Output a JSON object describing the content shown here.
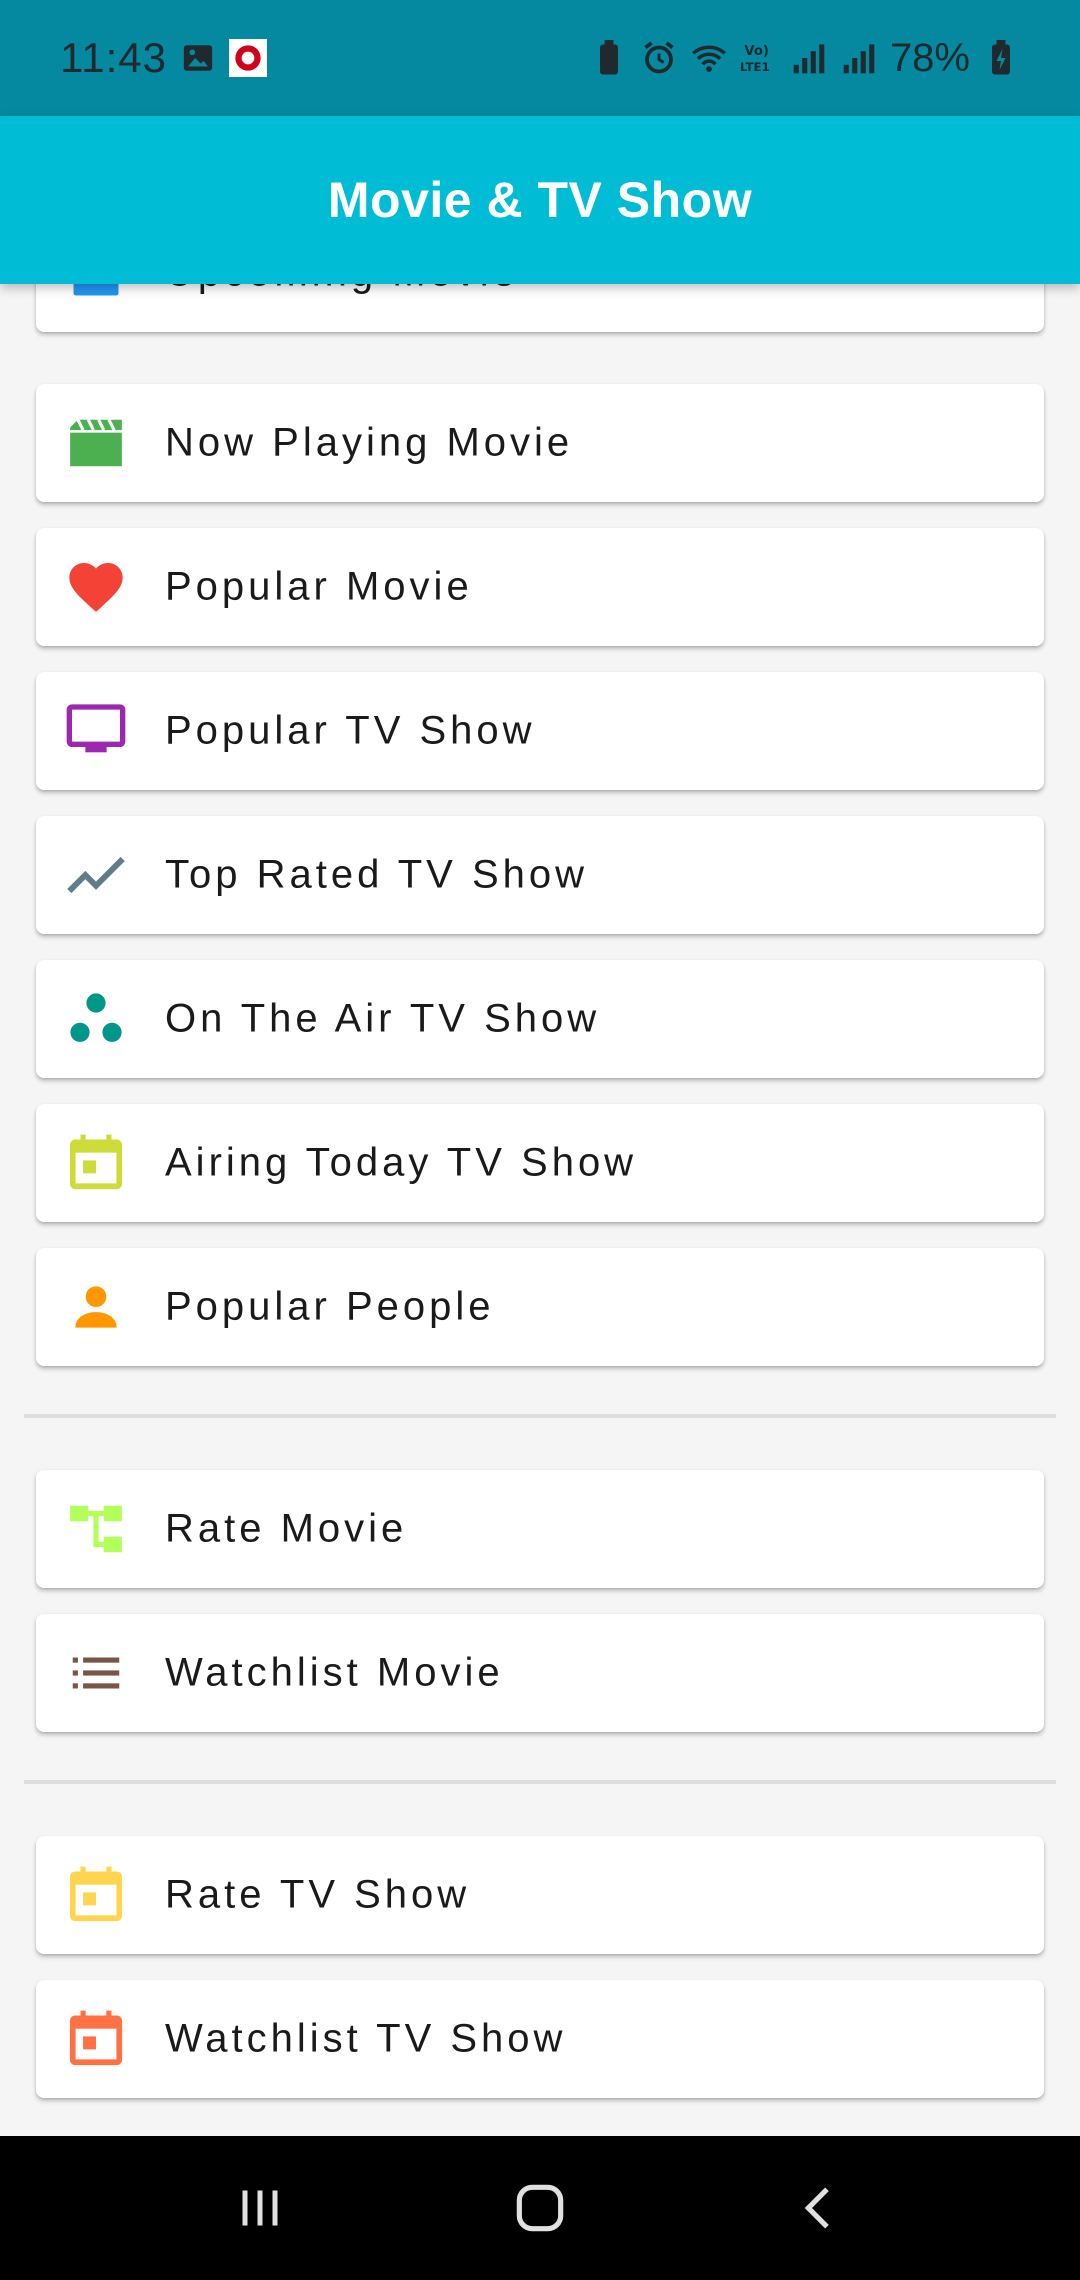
{
  "status_bar": {
    "time": "11:43",
    "battery": "78%",
    "network": "LTE1"
  },
  "app_bar": {
    "title": "Movie & TV Show"
  },
  "menu": {
    "section1": [
      {
        "label": "Upcoming Movie",
        "icon": "calendar-icon",
        "color": "#2196f3"
      },
      {
        "label": "Now Playing Movie",
        "icon": "clapperboard-icon",
        "color": "#4caf50"
      },
      {
        "label": "Popular Movie",
        "icon": "heart-icon",
        "color": "#f44336"
      },
      {
        "label": "Popular TV Show",
        "icon": "tv-icon",
        "color": "#9c27b0"
      },
      {
        "label": "Top Rated TV Show",
        "icon": "trending-up-icon",
        "color": "#607d8b"
      },
      {
        "label": "On The Air TV Show",
        "icon": "bubble-chart-icon",
        "color": "#009688"
      },
      {
        "label": "Airing Today TV Show",
        "icon": "event-icon",
        "color": "#cddc39"
      },
      {
        "label": "Popular People",
        "icon": "person-icon",
        "color": "#ff9800"
      }
    ],
    "section2": [
      {
        "label": "Rate Movie",
        "icon": "account-tree-icon",
        "color": "#b2ff59"
      },
      {
        "label": "Watchlist Movie",
        "icon": "list-icon",
        "color": "#795548"
      }
    ],
    "section3": [
      {
        "label": "Rate TV Show",
        "icon": "event-icon",
        "color": "#ffd54f"
      },
      {
        "label": "Watchlist TV Show",
        "icon": "event-icon",
        "color": "#ff7043"
      }
    ]
  }
}
